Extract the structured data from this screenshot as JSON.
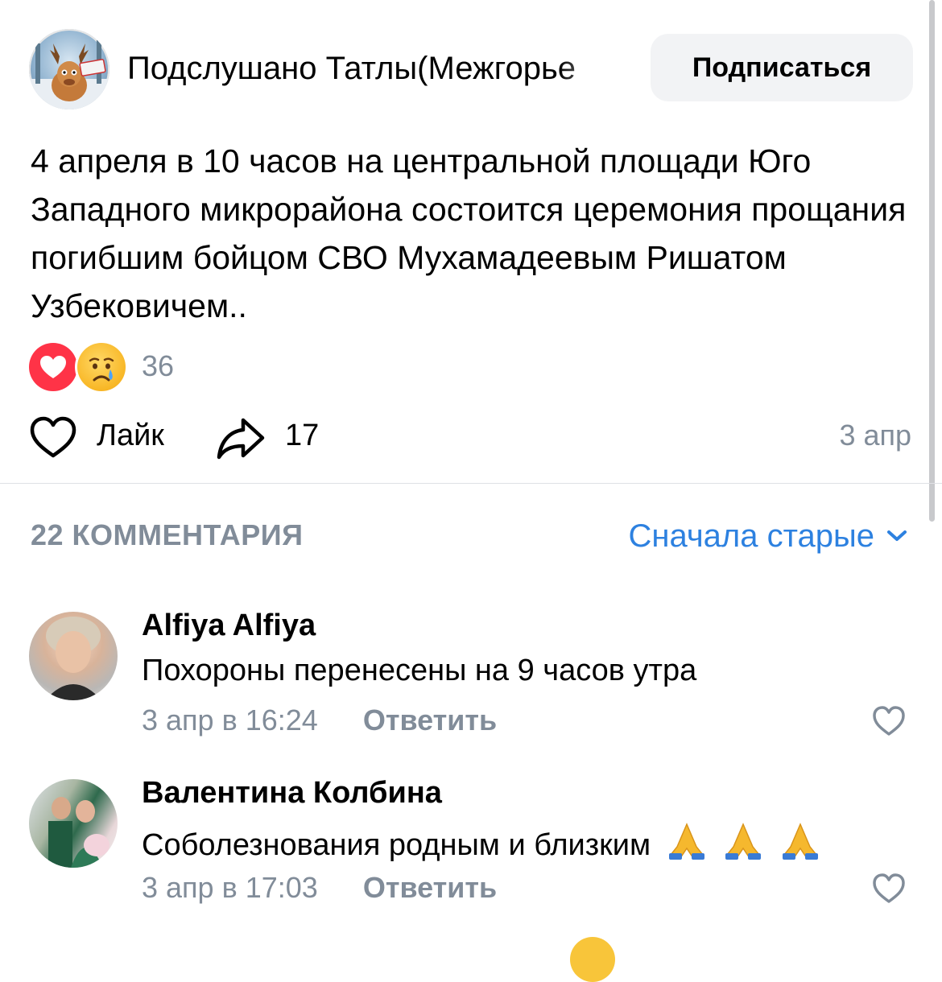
{
  "header": {
    "group_name": "Подслушано Татлы(Межгорье",
    "subscribe_label": "Подписаться"
  },
  "post": {
    "text": "4 апреля в 10 часов на центральной площади  Юго Западного микрорайона состоится церемония прощания погибшим бойцом СВО Мухамадеевым Ришатом Узбековичем..",
    "reactions_count": "36",
    "like_label": "Лайк",
    "share_count": "17",
    "date": "3 апр"
  },
  "comments_header": {
    "count_label": "22 КОММЕНТАРИЯ",
    "sort_label": "Сначала старые"
  },
  "comments": [
    {
      "author": "Alfiya Alfiya",
      "text": "Похороны перенесены на 9 часов утра",
      "time": "3 апр в 16:24",
      "reply_label": "Ответить"
    },
    {
      "author": "Валентина Колбина",
      "text": "Соболезнования родным и близким",
      "time": "3 апр в 17:03",
      "reply_label": "Ответить"
    }
  ],
  "colors": {
    "accent_link": "#2d81e0",
    "secondary_text": "#818c99",
    "heart_reaction": "#ff3347",
    "button_bg": "#f2f3f5"
  },
  "icons": {
    "reaction_1": "heart-icon",
    "reaction_2": "crying-face-icon",
    "like": "heart-outline-icon",
    "share": "share-arrow-icon",
    "sort": "chevron-down-icon",
    "comment_emoji": "folded-hands-icon"
  }
}
